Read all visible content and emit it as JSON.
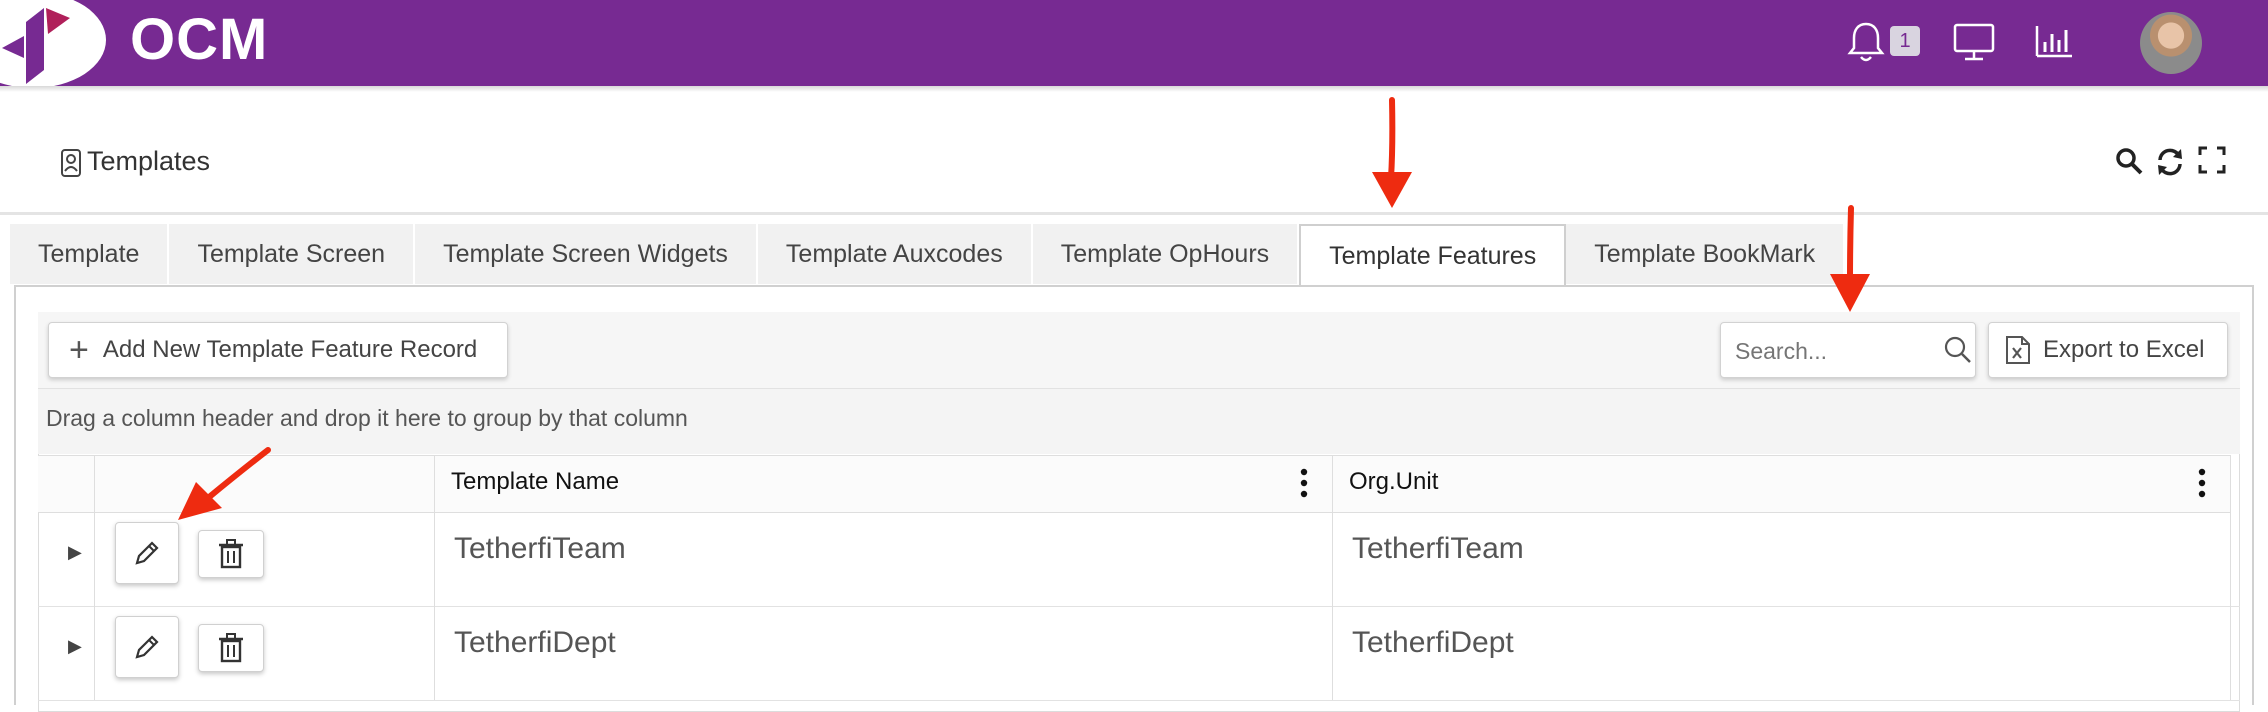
{
  "app": {
    "brand": "OCM",
    "notification_count": "1",
    "accent_color": "#772a92"
  },
  "header": {
    "page_title": "Templates",
    "icons": [
      "search-icon",
      "refresh-icon",
      "fullscreen-icon"
    ]
  },
  "tabs": [
    {
      "label": "Template",
      "active": false
    },
    {
      "label": "Template Screen",
      "active": false
    },
    {
      "label": "Template Screen Widgets",
      "active": false
    },
    {
      "label": "Template Auxcodes",
      "active": false
    },
    {
      "label": "Template OpHours",
      "active": false
    },
    {
      "label": "Template Features",
      "active": true
    },
    {
      "label": "Template BookMark",
      "active": false
    }
  ],
  "toolbar": {
    "add_label": "Add New Template Feature Record",
    "search_placeholder": "Search...",
    "export_label": "Export to Excel"
  },
  "grid": {
    "group_hint": "Drag a column header and drop it here to group by that column",
    "columns": [
      "Template Name",
      "Org.Unit"
    ],
    "rows": [
      {
        "template_name": "TetherfiTeam",
        "org_unit": "TetherfiTeam"
      },
      {
        "template_name": "TetherfiDept",
        "org_unit": "TetherfiDept"
      }
    ]
  }
}
